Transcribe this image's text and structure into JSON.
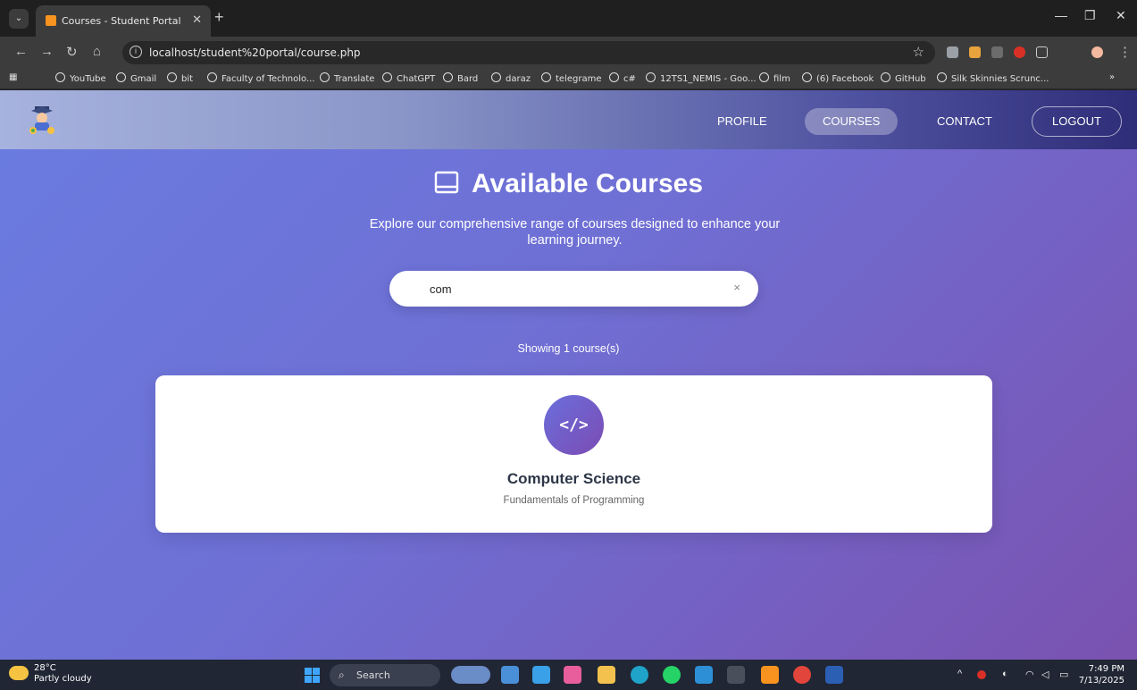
{
  "browser": {
    "tab_title": "Courses - Student Portal",
    "url": "localhost/student%20portal/course.php",
    "bookmarks": [
      "YouTube",
      "Gmail",
      "bit",
      "Faculty of Technolo...",
      "Translate",
      "ChatGPT",
      "Bard",
      "daraz",
      "telegrame",
      "c#",
      "12TS1_NEMIS - Goo...",
      "film",
      "(6) Facebook",
      "GitHub",
      "Silk Skinnies Scrunc..."
    ],
    "overflow_label": "»"
  },
  "nav": {
    "links": [
      "PROFILE",
      "COURSES",
      "CONTACT"
    ],
    "logout": "LOGOUT"
  },
  "main": {
    "title": "Available Courses",
    "subtitle": "Explore our comprehensive range of courses designed to enhance your learning journey.",
    "search_value": "com",
    "clear_label": "×",
    "result_count": "Showing 1 course(s)"
  },
  "courses": [
    {
      "icon_text": "</>",
      "title": "Computer Science",
      "description": "Fundamentals of Programming"
    }
  ],
  "taskbar": {
    "temperature": "28°C",
    "weather": "Partly cloudy",
    "search_label": "Search",
    "time": "7:49 PM",
    "date": "7/13/2025"
  }
}
